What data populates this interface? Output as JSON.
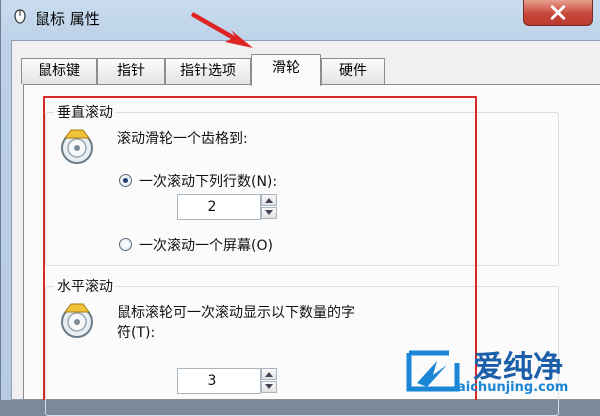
{
  "window": {
    "title": "鼠标 属性"
  },
  "tabs": [
    {
      "label": "鼠标键",
      "active": false
    },
    {
      "label": "指针",
      "active": false
    },
    {
      "label": "指针选项",
      "active": false
    },
    {
      "label": "滑轮",
      "active": true
    },
    {
      "label": "硬件",
      "active": false
    }
  ],
  "vertical": {
    "title": "垂直滚动",
    "prompt": "滚动滑轮一个齿格到:",
    "option_lines": "一次滚动下列行数(N):",
    "lines_value": "2",
    "option_screen": "一次滚动一个屏幕(O)"
  },
  "horizontal": {
    "title": "水平滚动",
    "prompt_line1": "鼠标滚轮可一次滚动显示以下数量的字",
    "prompt_line2": "符(T):",
    "chars_value": "3"
  },
  "watermark": {
    "brand": "爱纯净",
    "url": "aichunjing.com"
  },
  "colors": {
    "highlight": "#d62a2a",
    "titlebar": "#c9dcef",
    "close": "#c8473a"
  }
}
